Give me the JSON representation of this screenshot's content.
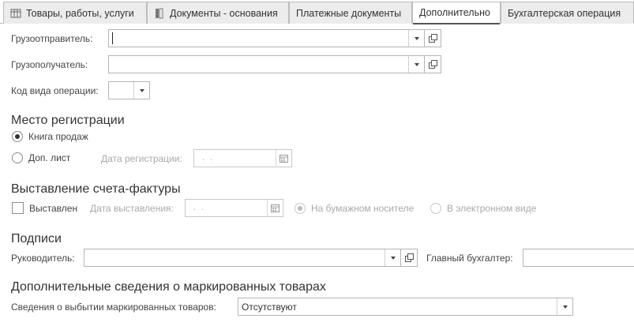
{
  "tabs": [
    {
      "label": "Товары, работы, услуги",
      "icon": "table-icon"
    },
    {
      "label": "Документы - основания",
      "icon": "documents-icon"
    },
    {
      "label": "Платежные документы"
    },
    {
      "label": "Дополнительно",
      "active": true
    },
    {
      "label": "Бухгалтерская операция"
    }
  ],
  "fields": {
    "shipper_label": "Грузоотправитель:",
    "shipper_value": "",
    "consignee_label": "Грузополучатель:",
    "consignee_value": "",
    "op_code_label": "Код вида операции:",
    "op_code_value": ""
  },
  "registration": {
    "title": "Место регистрации",
    "sales_book": "Книга продаж",
    "additional_sheet": "Доп. лист",
    "reg_date_label": "Дата регистрации:",
    "reg_date_value": " .  ."
  },
  "invoice": {
    "title": "Выставление счета-фактуры",
    "issued_label": "Выставлен",
    "issue_date_label": "Дата выставления:",
    "issue_date_value": " .  .",
    "paper": "На бумажном носителе",
    "electronic": "В электронном виде"
  },
  "signatures": {
    "title": "Подписи",
    "head_label": "Руководитель:",
    "head_value": "",
    "accountant_label": "Главный бухгалтер:",
    "accountant_value": ""
  },
  "marked": {
    "title": "Дополнительные сведения о маркированных товарах",
    "disposal_label": "Сведения о выбытии маркированных товаров:",
    "disposal_value": "Отсутствуют"
  }
}
